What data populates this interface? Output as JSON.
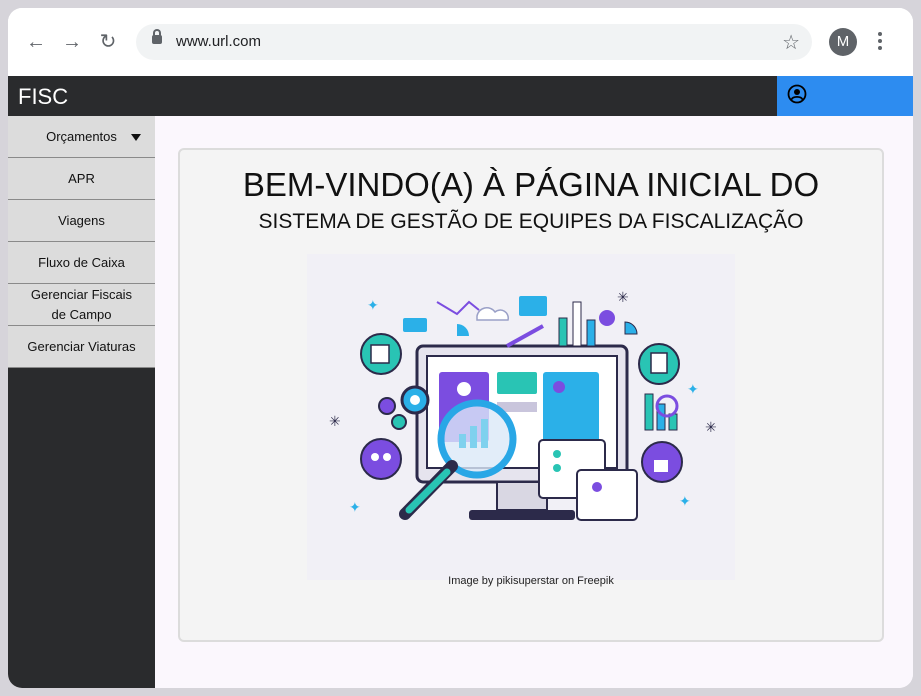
{
  "browser": {
    "url": "www.url.com",
    "profile_initial": "M",
    "icons": [
      "back-arrow-icon",
      "forward-arrow-icon",
      "reload-icon",
      "lock-icon",
      "star-icon",
      "kebab-menu-icon"
    ]
  },
  "app": {
    "brand": "FISC",
    "colors": {
      "topbar": "#2a2b2d",
      "user_button": "#2d8cf0",
      "menu_bg": "#dcdcdc",
      "main_bg": "#fbf7fd"
    }
  },
  "sidebar": {
    "items": [
      {
        "label": "Orçamentos"
      },
      {
        "label": "APR"
      },
      {
        "label": "Viagens"
      },
      {
        "label": "Fluxo de Caixa"
      },
      {
        "label": "Gerenciar Fiscais de Campo"
      },
      {
        "label": "Gerenciar Viaturas"
      }
    ]
  },
  "main": {
    "title_line1": "BEM-VINDO(A) À PÁGINA INICIAL DO",
    "title_line2": "SISTEMA DE GESTÃO DE EQUIPES DA FISCALIZAÇÃO",
    "image_credit": "Image by pikisuperstar on Freepik"
  }
}
